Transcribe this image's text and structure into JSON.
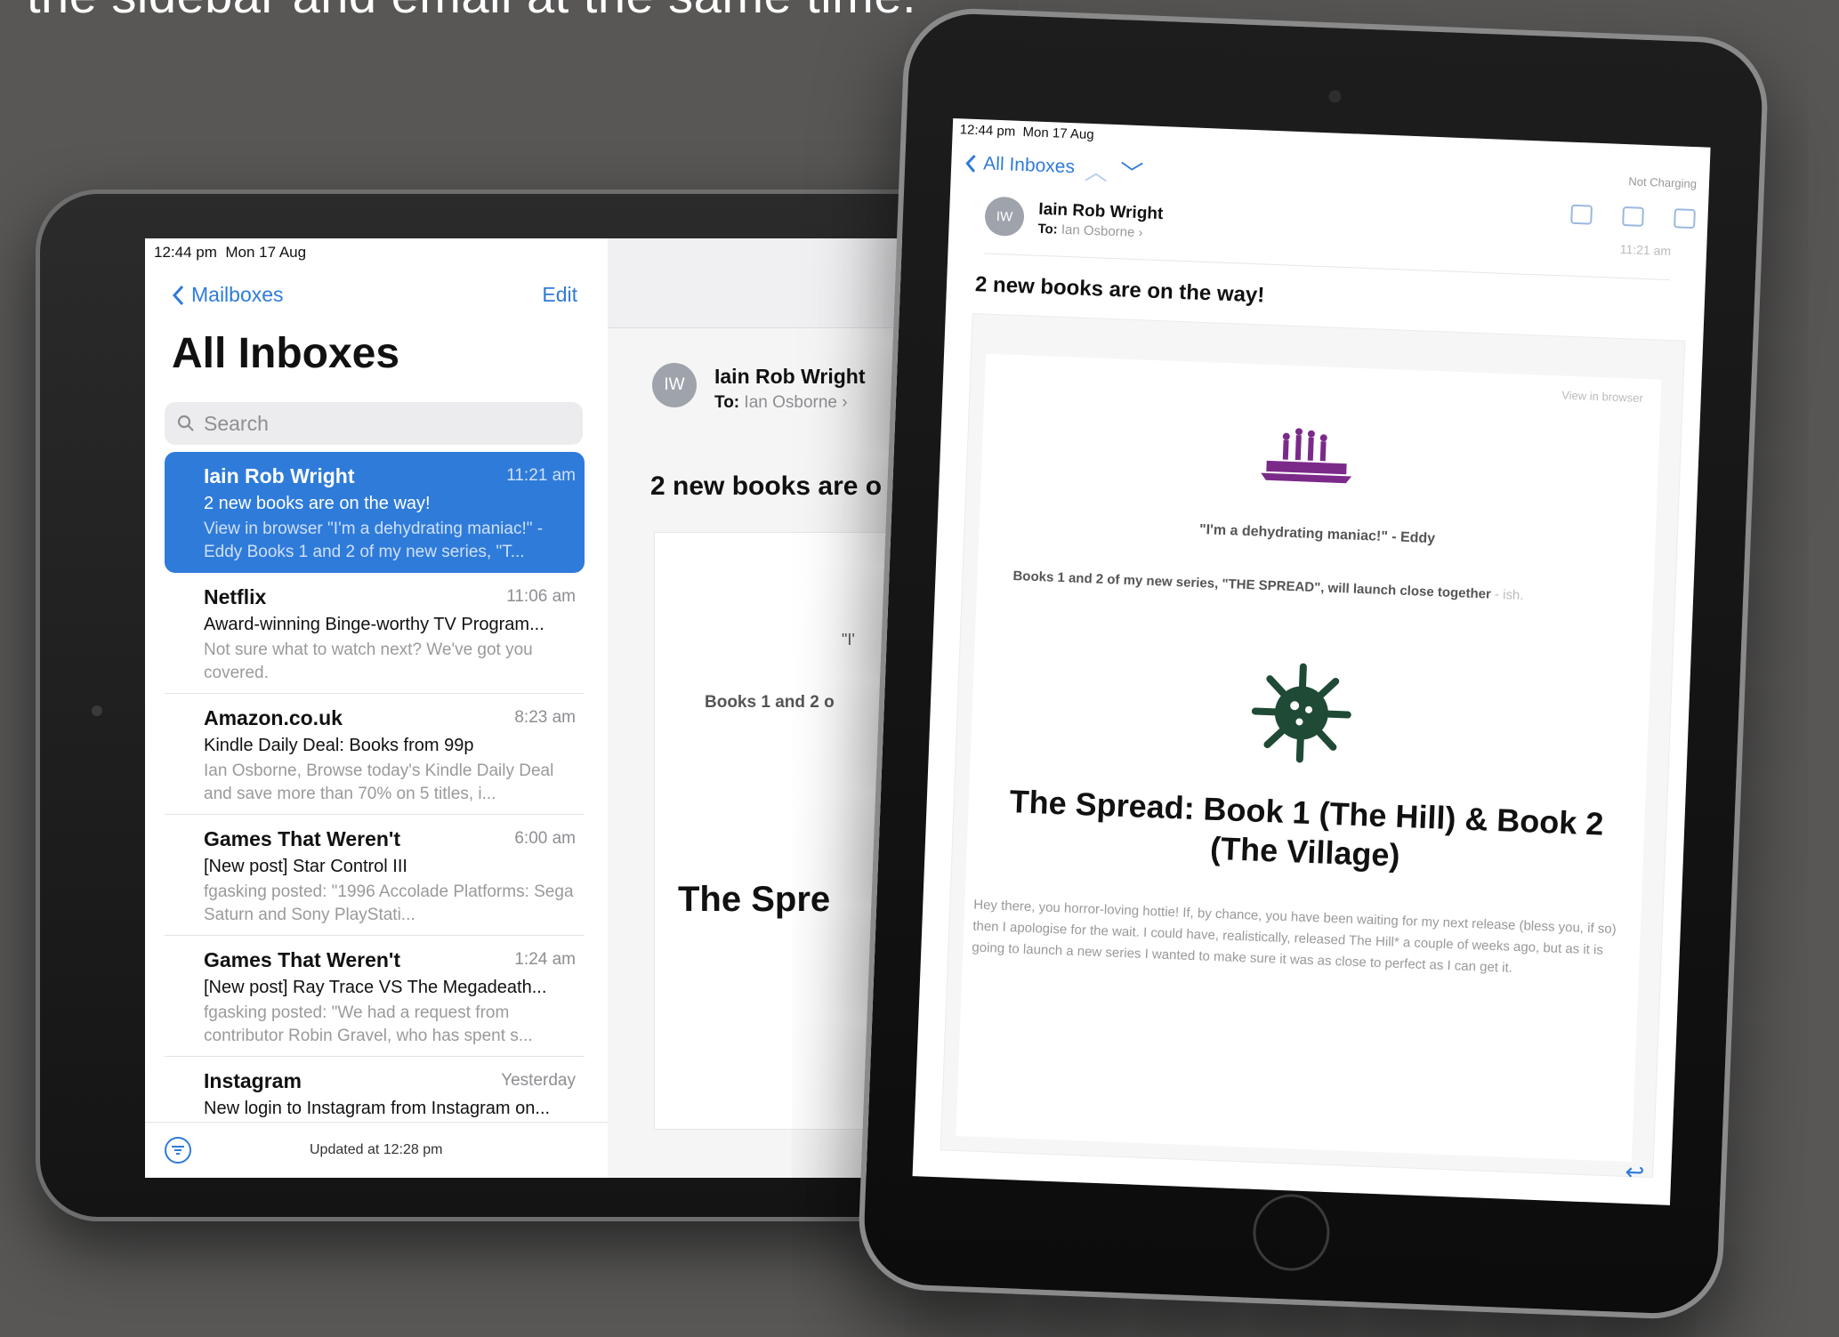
{
  "caption": "the sidebar and email at the same time.",
  "status_bar": {
    "time": "12:44 pm",
    "date": "Mon 17 Aug",
    "battery": "Not Charging"
  },
  "sidebar": {
    "back_label": "Mailboxes",
    "edit_label": "Edit",
    "title": "All Inboxes",
    "search_placeholder": "Search",
    "updated_text": "Updated at 12:28 pm",
    "mails": [
      {
        "sender": "Iain Rob Wright",
        "time": "11:21 am",
        "subject": "2 new books are on the way!",
        "preview": "View in browser \"I'm a dehydrating maniac!\" - Eddy Books 1 and 2 of my new series, \"T...",
        "selected": true
      },
      {
        "sender": "Netflix",
        "time": "11:06 am",
        "subject": "Award-winning Binge-worthy TV Program...",
        "preview": "Not sure what to watch next? We've got you covered.",
        "selected": false
      },
      {
        "sender": "Amazon.co.uk",
        "time": "8:23 am",
        "subject": "Kindle Daily Deal: Books from 99p",
        "preview": "Ian Osborne, Browse today's Kindle Daily Deal and save more than 70% on 5 titles, i...",
        "selected": false
      },
      {
        "sender": "Games That Weren't",
        "time": "6:00 am",
        "subject": "[New post] Star Control III",
        "preview": "fgasking posted: \"1996 Accolade Platforms: Sega Saturn and Sony PlayStati...",
        "selected": false
      },
      {
        "sender": "Games That Weren't",
        "time": "1:24 am",
        "subject": "[New post] Ray Trace VS The Megadeath...",
        "preview": "fgasking posted: \"We had a request from contributor Robin Gravel, who has spent s...",
        "selected": false
      },
      {
        "sender": "Instagram",
        "time": "Yesterday",
        "subject": "New login to Instagram from Instagram on...",
        "preview": "",
        "selected": false
      }
    ]
  },
  "email": {
    "avatar_initials": "IW",
    "from": "Iain Rob Wright",
    "to_label": "To:",
    "to": "Ian Osborne",
    "time": "11:21 am",
    "subject": "2 new books are on the way!",
    "subject_clipped": "2 new books are o",
    "view_in_browser": "View in browser",
    "quote": "\"I'm a dehydrating maniac!\" - Eddy",
    "quote_clipped": "\"I'",
    "books_line": "Books 1 and 2 of my new series, \"THE SPREAD\", will launch close together",
    "books_line_tail": " - ish.",
    "books_clipped": "Books 1 and 2 o",
    "heading": "The Spread: Book 1 (The Hill) & Book 2 (The Village)",
    "heading_clipped": "The Spre",
    "paragraph": "Hey there, you horror-loving hottie! If, by chance, you have been waiting for my next release (bless you, if so) then I apologise for the wait. I could have, realistically, released The Hill* a couple of weeks ago, but as it is going to launch a new series I wanted to make sure it was as close to perfect as I can get it."
  },
  "portrait_nav": {
    "back_label": "All Inboxes"
  },
  "colors": {
    "accent": "#2f7bd9",
    "background": "#585756",
    "virus_green": "#1f4a36",
    "logo_purple": "#7b2a8a"
  }
}
